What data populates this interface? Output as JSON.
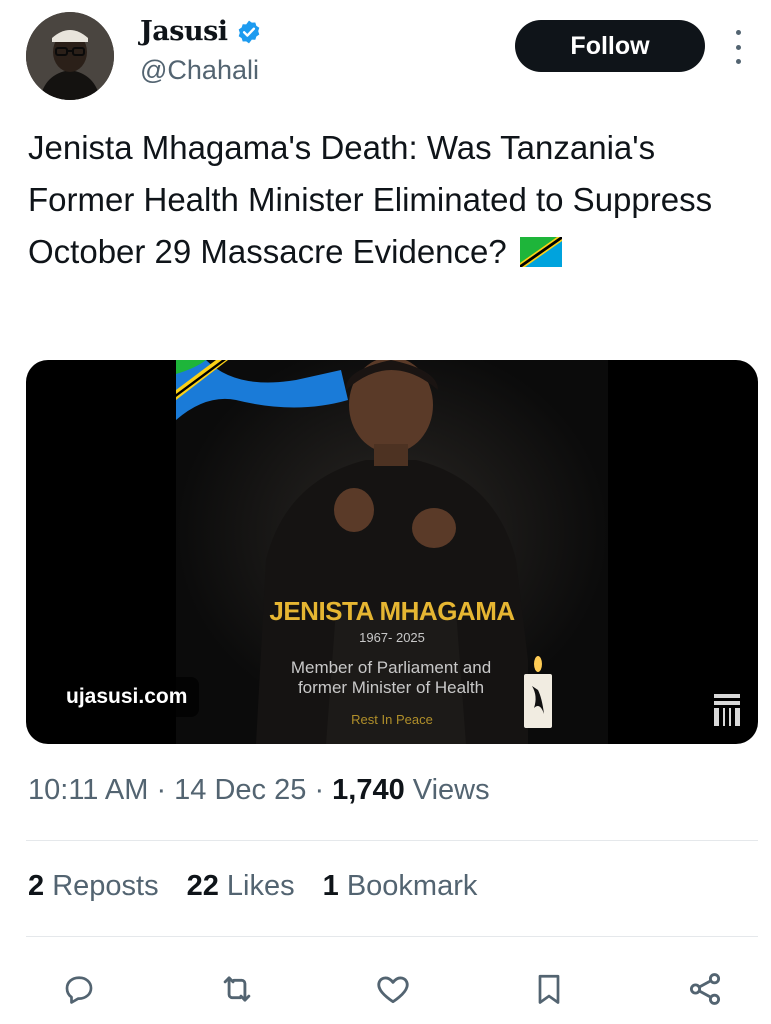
{
  "author": {
    "name": "Jasusi",
    "handle": "@Chahali",
    "verified_color": "#1d9bf0"
  },
  "follow_label": "Follow",
  "tweet": {
    "text": "Jenista Mhagama's Death: Was Tanzania's Former Health Minister Eliminated to Suppress October 29 Massacre Evidence?",
    "emoji": "tanzania-flag"
  },
  "media": {
    "poster_name": "JENISTA MHAGAMA",
    "poster_years": "1967- 2025",
    "poster_role_line1": "Member of Parliament and",
    "poster_role_line2": "former Minister of Health",
    "poster_rip": "Rest In Peace",
    "source": "ujasusi.com"
  },
  "meta": {
    "time": "10:11 AM",
    "date": "14 Dec 25",
    "views_count": "1,740",
    "views_label": "Views"
  },
  "stats": {
    "reposts_count": "2",
    "reposts_label": "Reposts",
    "likes_count": "22",
    "likes_label": "Likes",
    "bookmarks_count": "1",
    "bookmarks_label": "Bookmark"
  },
  "icons": [
    "reply-icon",
    "repost-icon",
    "like-icon",
    "bookmark-icon",
    "share-icon"
  ],
  "colors": {
    "text": "#0f1419",
    "secondary": "#536471",
    "poster_gold": "#e6b632"
  }
}
